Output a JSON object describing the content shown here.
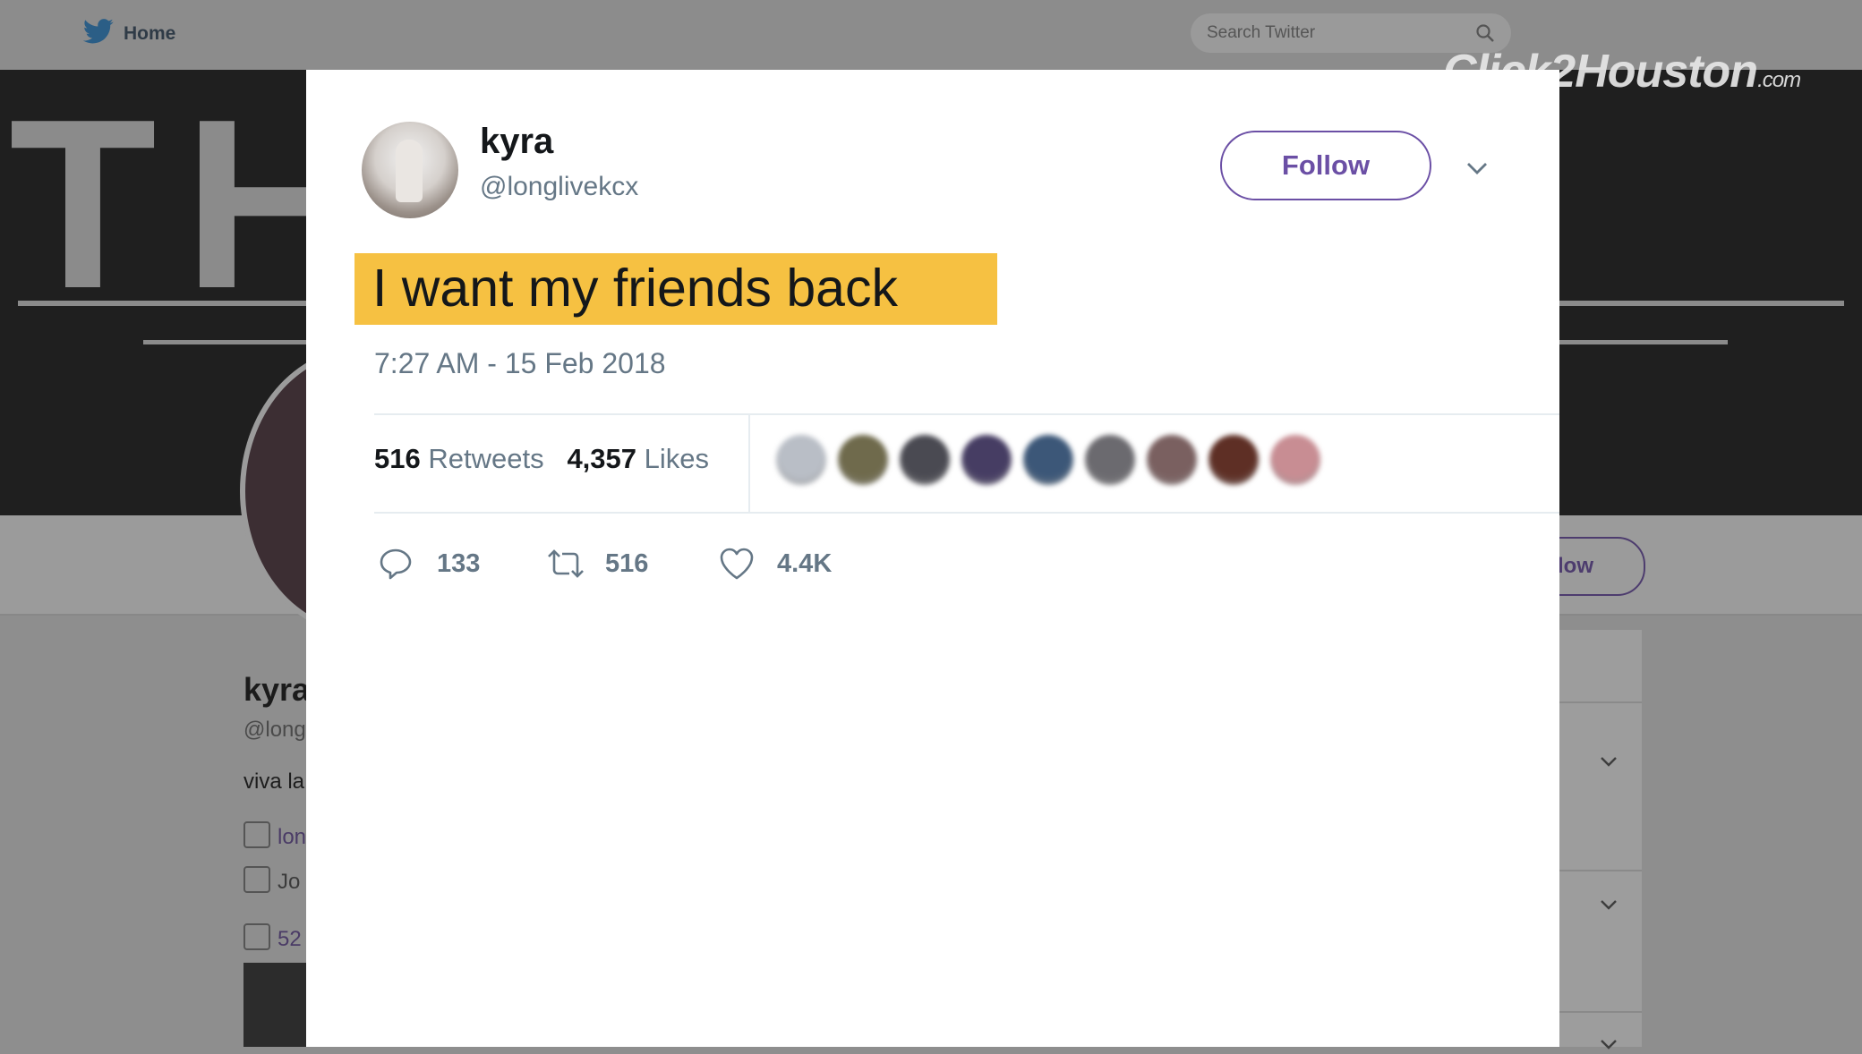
{
  "header": {
    "home_label": "Home",
    "search_placeholder": "Search Twitter"
  },
  "watermark": {
    "brand": "Click2Houston",
    "suffix": ".com"
  },
  "background_profile": {
    "banner_text": "TH        SE",
    "name_partial": "kyra",
    "handle_partial": "@long",
    "bio_partial": "viva la",
    "link_partial": "lon",
    "joined_partial": "Jo",
    "photos_partial": "52",
    "follow_partial": "low"
  },
  "tweet": {
    "name": "kyra",
    "handle": "@longlivekcx",
    "follow_label": "Follow",
    "text": "I want my friends back",
    "timestamp": "7:27 AM - 15 Feb 2018",
    "retweets_count": "516",
    "retweets_label": "Retweets",
    "likes_count": "4,357",
    "likes_label": "Likes",
    "highlight_color": "#f6c142",
    "accent_color": "#6b4fa5"
  },
  "likers": [
    {
      "color": "#b9bec6"
    },
    {
      "color": "#6f6a4c"
    },
    {
      "color": "#4a4a52"
    },
    {
      "color": "#463d63"
    },
    {
      "color": "#3c5778"
    },
    {
      "color": "#6b6a6f"
    },
    {
      "color": "#7a6060"
    },
    {
      "color": "#5e2f25"
    },
    {
      "color": "#c88d93"
    }
  ],
  "actions": {
    "replies": "133",
    "retweets": "516",
    "likes": "4.4K"
  }
}
